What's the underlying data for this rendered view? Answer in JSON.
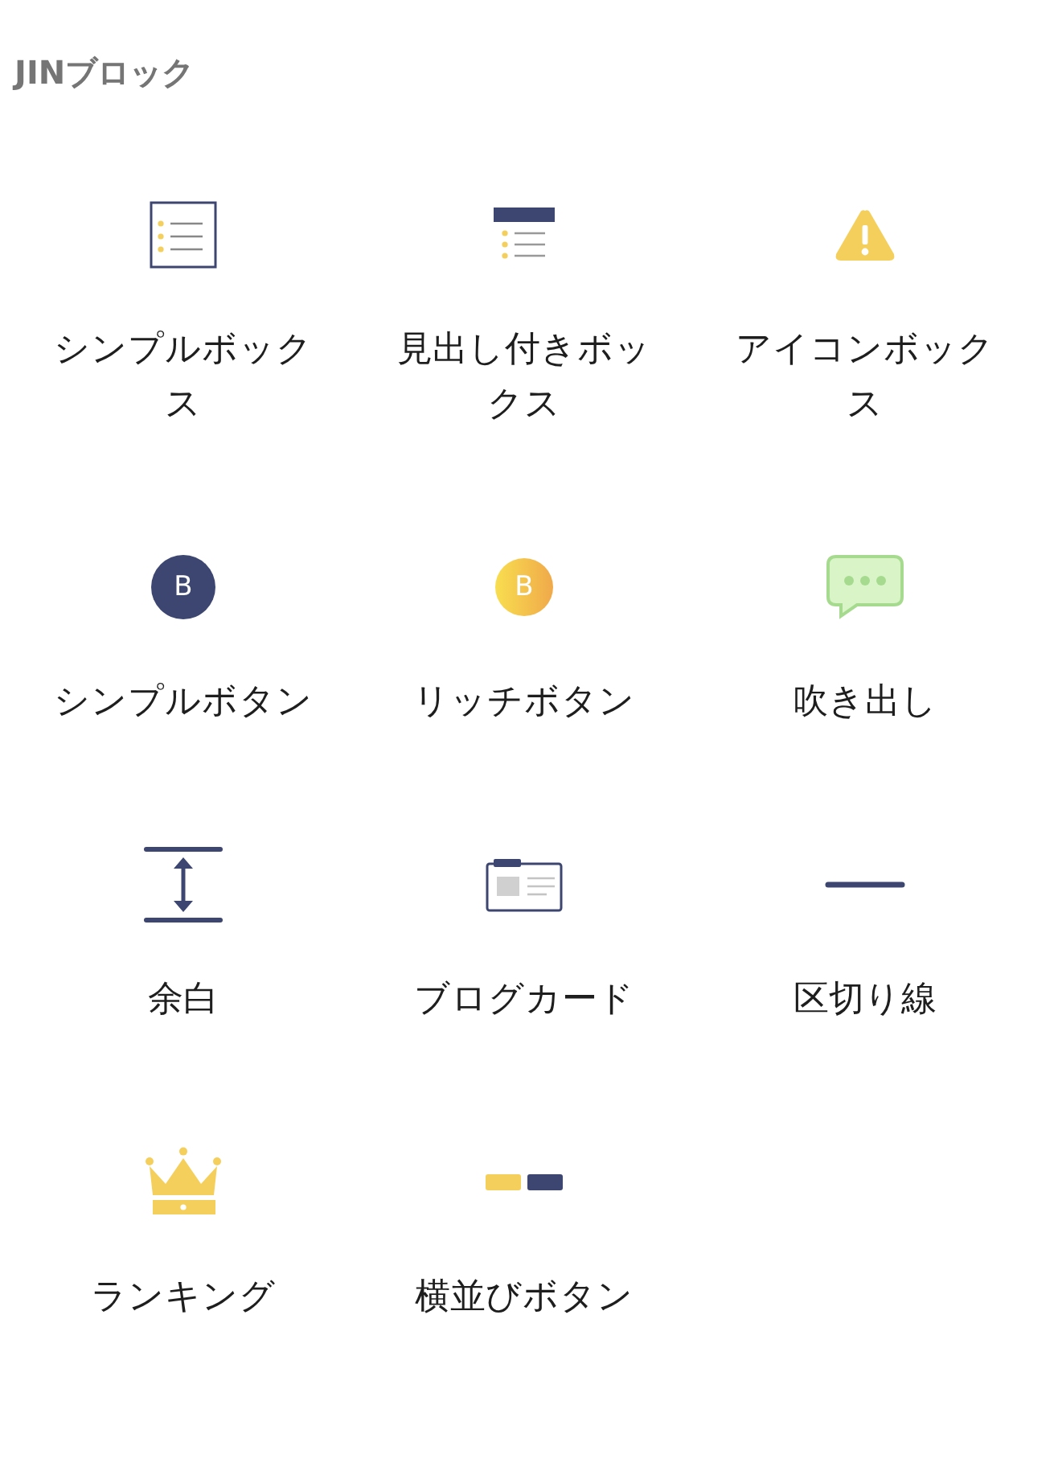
{
  "heading": "JINブロック",
  "blocks": [
    {
      "kind": "simple-box",
      "label": "シンプルボックス"
    },
    {
      "kind": "heading-box",
      "label": "見出し付きボックス"
    },
    {
      "kind": "icon-box",
      "label": "アイコンボックス"
    },
    {
      "kind": "simple-button",
      "label": "シンプルボタン",
      "badge": "B"
    },
    {
      "kind": "rich-button",
      "label": "リッチボタン",
      "badge": "B"
    },
    {
      "kind": "speech-bubble",
      "label": "吹き出し"
    },
    {
      "kind": "spacer",
      "label": "余白"
    },
    {
      "kind": "blog-card",
      "label": "ブログカード"
    },
    {
      "kind": "divider",
      "label": "区切り線"
    },
    {
      "kind": "ranking",
      "label": "ランキング"
    },
    {
      "kind": "side-buttons",
      "label": "横並びボタン"
    }
  ]
}
